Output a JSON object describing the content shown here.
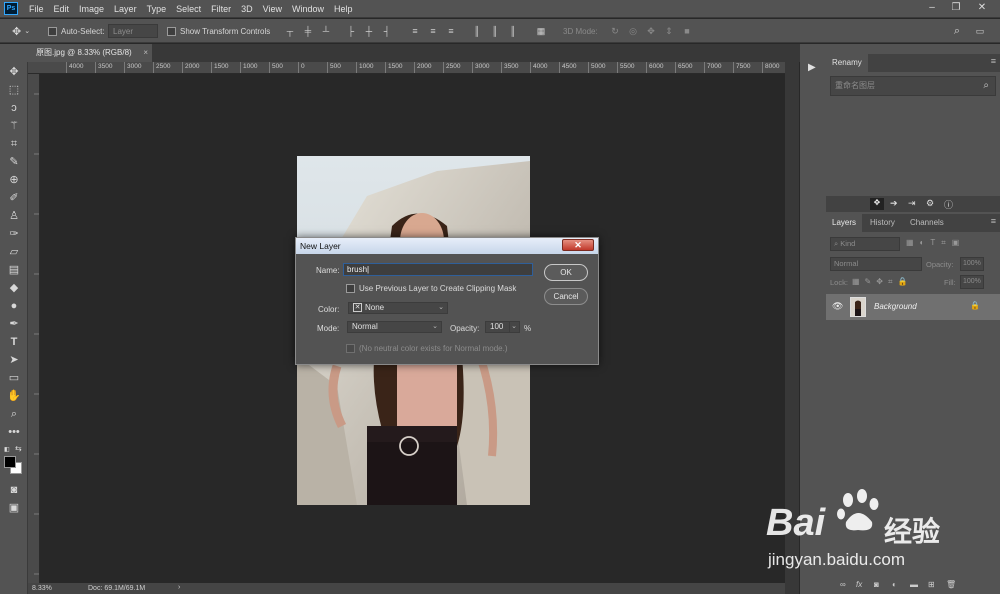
{
  "menubar": {
    "logo": "Ps",
    "items": [
      "File",
      "Edit",
      "Image",
      "Layer",
      "Type",
      "Select",
      "Filter",
      "3D",
      "View",
      "Window",
      "Help"
    ],
    "min": "–",
    "restore": "❐",
    "close": "✕"
  },
  "options": {
    "auto_select_label": "Auto-Select:",
    "auto_select_value": "Layer",
    "show_transform_label": "Show Transform Controls",
    "mode_3d_label": "3D Mode:"
  },
  "document": {
    "tab_title": "原图.jpg @ 8.33% (RGB/8)",
    "tab_close": "×",
    "zoom": "8.33%",
    "doc_info": "Doc: 69.1M/69.1M",
    "ruler_labels": [
      "4000",
      "3500",
      "3000",
      "2500",
      "2000",
      "1500",
      "1000",
      "500",
      "0",
      "500",
      "1000",
      "1500",
      "2000",
      "2500",
      "3000",
      "3500",
      "4000",
      "4500",
      "5000",
      "5500",
      "6000",
      "6500",
      "7000",
      "7500",
      "8000"
    ]
  },
  "panels": {
    "top_tab": "Renamy",
    "search_placeholder": "重命名图层",
    "tabs": [
      "Layers",
      "History",
      "Channels"
    ],
    "kind_label": "Kind",
    "blend_mode": "Normal",
    "opacity_label": "Opacity:",
    "opacity_value": "100%",
    "lock_label": "Lock:",
    "fill_label": "Fill:",
    "fill_value": "100%",
    "layer_name": "Background"
  },
  "dialog": {
    "title": "New Layer",
    "name_label": "Name:",
    "name_value": "brush",
    "clip_label": "Use Previous Layer to Create Clipping Mask",
    "color_label": "Color:",
    "color_value": "None",
    "mode_label": "Mode:",
    "mode_value": "Normal",
    "opacity_label": "Opacity:",
    "opacity_value": "100",
    "percent": "%",
    "neutral_note": "(No neutral color exists for Normal mode.)",
    "ok": "OK",
    "cancel": "Cancel",
    "close": "✕"
  }
}
